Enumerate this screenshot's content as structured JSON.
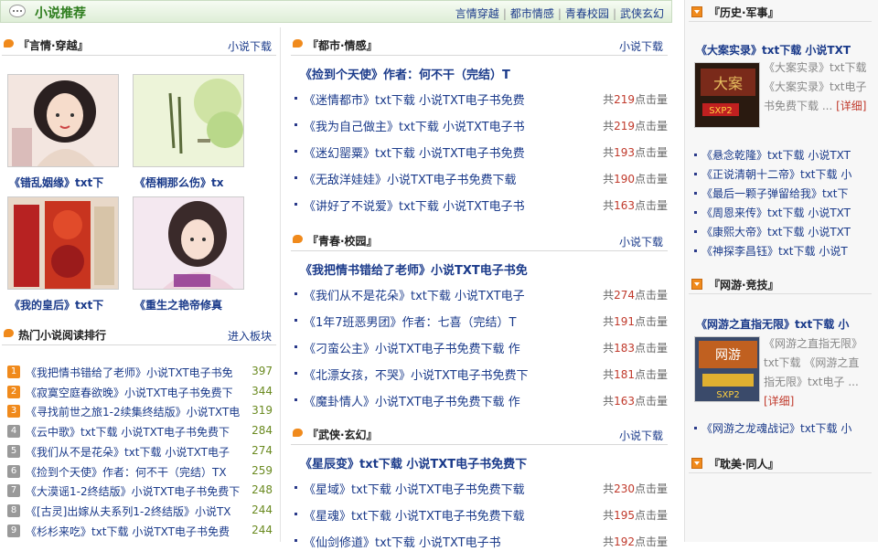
{
  "header": {
    "title": "小说推荐",
    "tabs": [
      "言情穿越",
      "都市情感",
      "青春校园",
      "武侠玄幻"
    ]
  },
  "left": {
    "section1": {
      "title": "『言情·穿越』",
      "more": "小说下载",
      "books": [
        {
          "caption": "《错乱姻缘》txt下"
        },
        {
          "caption": "《梧桐那么伤》tx"
        },
        {
          "caption": "《我的皇后》txt下"
        },
        {
          "caption": "《重生之艳帝修真"
        }
      ]
    },
    "rank": {
      "title": "热门小说阅读排行",
      "more": "进入板块",
      "items": [
        {
          "num": "1",
          "title": "《我把情书错给了老师》小说TXT电子书免",
          "count": "397"
        },
        {
          "num": "2",
          "title": "《寂寞空庭春欲晚》小说TXT电子书免费下",
          "count": "344"
        },
        {
          "num": "3",
          "title": "《寻找前世之旅1-2续集终结版》小说TXT电",
          "count": "319"
        },
        {
          "num": "4",
          "title": "《云中歌》txt下载 小说TXT电子书免费下",
          "count": "284"
        },
        {
          "num": "5",
          "title": "《我们从不是花朵》txt下载 小说TXT电子",
          "count": "274"
        },
        {
          "num": "6",
          "title": "《捡到个天使》作者：何不干（完结）TX",
          "count": "259"
        },
        {
          "num": "7",
          "title": "《大漠谣1-2终结版》小说TXT电子书免费下",
          "count": "248"
        },
        {
          "num": "8",
          "title": "《[古灵]出嫁从夫系列1-2终结版》小说TX",
          "count": "244"
        },
        {
          "num": "9",
          "title": "《杉杉来吃》txt下载 小说TXT电子书免费",
          "count": "244"
        }
      ]
    }
  },
  "middle": {
    "sections": [
      {
        "title": "『都市·情感』",
        "more": "小说下载",
        "featured": "《捡到个天使》作者：何不干（完结）T",
        "rows": [
          {
            "title": "《迷情都市》txt下载 小说TXT电子书免费",
            "pre": "共",
            "count": "219",
            "post": "点击量"
          },
          {
            "title": "《我为自己做主》txt下载 小说TXT电子书",
            "pre": "共",
            "count": "219",
            "post": "点击量"
          },
          {
            "title": "《迷幻罂粟》txt下载 小说TXT电子书免费",
            "pre": "共",
            "count": "193",
            "post": "点击量"
          },
          {
            "title": "《无敌洋娃娃》小说TXT电子书免费下载",
            "pre": "共",
            "count": "190",
            "post": "点击量"
          },
          {
            "title": "《讲好了不说爱》txt下载 小说TXT电子书",
            "pre": "共",
            "count": "163",
            "post": "点击量"
          }
        ]
      },
      {
        "title": "『青春·校园』",
        "more": "小说下载",
        "featured": "《我把情书错给了老师》小说TXT电子书免",
        "rows": [
          {
            "title": "《我们从不是花朵》txt下载 小说TXT电子",
            "pre": "共",
            "count": "274",
            "post": "点击量"
          },
          {
            "title": "《1年7班恶男团》作者：七喜（完结）T",
            "pre": "共",
            "count": "191",
            "post": "点击量"
          },
          {
            "title": "《刁蛮公主》小说TXT电子书免费下载 作",
            "pre": "共",
            "count": "183",
            "post": "点击量"
          },
          {
            "title": "《北漂女孩，不哭》小说TXT电子书免费下",
            "pre": "共",
            "count": "181",
            "post": "点击量"
          },
          {
            "title": "《魔卦情人》小说TXT电子书免费下载 作",
            "pre": "共",
            "count": "163",
            "post": "点击量"
          }
        ]
      },
      {
        "title": "『武侠·玄幻』",
        "more": "小说下载",
        "featured": "《星辰变》txt下载 小说TXT电子书免费下",
        "rows": [
          {
            "title": "《星域》txt下载 小说TXT电子书免费下载",
            "pre": "共",
            "count": "230",
            "post": "点击量"
          },
          {
            "title": "《星魂》txt下载 小说TXT电子书免费下载",
            "pre": "共",
            "count": "195",
            "post": "点击量"
          },
          {
            "title": "《仙剑修道》txt下载 小说TXT电子书",
            "pre": "共",
            "count": "192",
            "post": "点击量"
          }
        ]
      }
    ]
  },
  "right": {
    "sec1": {
      "title": "『历史·军事』",
      "featured": "《大案实录》txt下载 小说TXT",
      "desc": "《大案实录》txt下载 《大案实录》txt电子书免费下载 ... ",
      "detail": "[详细]",
      "rows": [
        "《悬念乾隆》txt下载 小说TXT",
        "《正说清朝十二帝》txt下载 小",
        "《最后一颗子弹留给我》txt下",
        "《周恩来传》txt下载 小说TXT",
        "《康熙大帝》txt下载 小说TXT",
        "《神探李昌钰》txt下载 小说T"
      ]
    },
    "sec2": {
      "title": "『网游·竞技』",
      "featured": "《网游之直指无限》txt下载 小",
      "desc": "《网游之直指无限》txt下载 《网游之直指无限》txt电子 ... ",
      "detail": "[详细]",
      "rows": [
        "《网游之龙魂战记》txt下载 小"
      ]
    },
    "sec3": {
      "title": "『耽美·同人』"
    }
  },
  "colors": {
    "accent_green": "#2e7d1e",
    "link": "#1a3a8a",
    "count_red": "#c0392b",
    "rank_top": "#f08a1c",
    "rank_other": "#999999"
  }
}
